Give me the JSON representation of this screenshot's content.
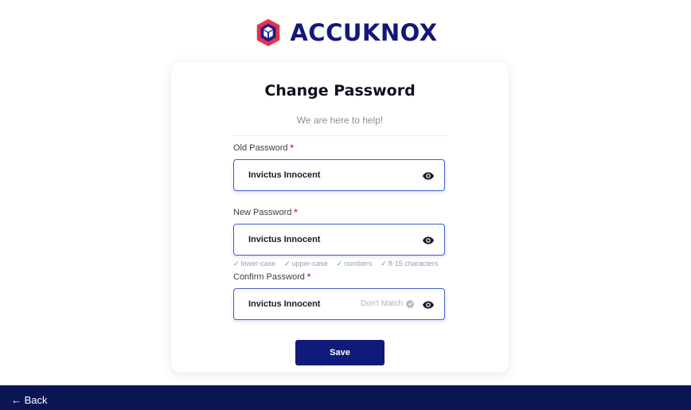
{
  "brand": {
    "name": "ACCUKNOX",
    "colors": {
      "primary": "#14187a",
      "accent": "#e8314b"
    }
  },
  "form": {
    "title": "Change Password",
    "subtitle": "We are here to help!",
    "fields": [
      {
        "label": "Old Password",
        "required": "*",
        "value": "Invictus Innocent",
        "icon": "eye-icon"
      },
      {
        "label": "New Password",
        "required": "*",
        "value": "Invictus Innocent",
        "icon": "eye-icon"
      },
      {
        "label": "Confirm Password",
        "required": "*",
        "value": "Invictus Innocent",
        "icon": "eye-icon",
        "status": "Don't Match"
      }
    ],
    "rules": [
      "lower-case",
      "upper-case",
      "numbers",
      "8-15 characters"
    ],
    "save_label": "Save"
  },
  "footer": {
    "back_label": "← Back",
    "background": "#0b1554"
  }
}
